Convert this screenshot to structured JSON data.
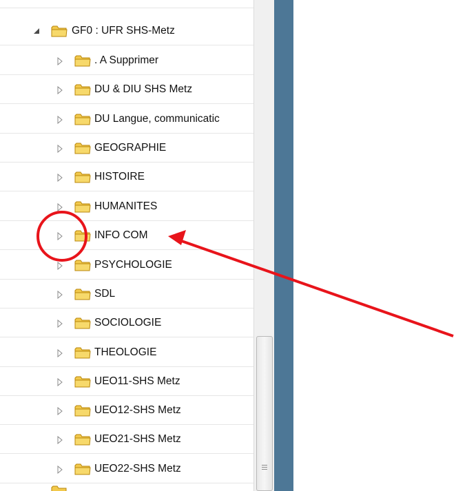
{
  "tree": {
    "parent": {
      "label": "GF0 : UFR SHS-Metz"
    },
    "children": [
      {
        "label": ". A Supprimer"
      },
      {
        "label": "DU & DIU SHS Metz"
      },
      {
        "label": "DU Langue, communicatic"
      },
      {
        "label": "GEOGRAPHIE"
      },
      {
        "label": "HISTOIRE"
      },
      {
        "label": "HUMANITES"
      },
      {
        "label": "INFO COM"
      },
      {
        "label": "PSYCHOLOGIE"
      },
      {
        "label": "SDL"
      },
      {
        "label": "SOCIOLOGIE"
      },
      {
        "label": "THEOLOGIE"
      },
      {
        "label": "UEO11-SHS Metz"
      },
      {
        "label": "UEO12-SHS Metz"
      },
      {
        "label": "UEO21-SHS Metz"
      },
      {
        "label": "UEO22-SHS Metz"
      }
    ]
  },
  "icons": {
    "folder": "folder-icon",
    "expand_collapsed": "triangle-right-icon",
    "expand_expanded": "triangle-down-icon"
  },
  "colors": {
    "annotation_red": "#e8141b",
    "side_pane_blue": "#4d7796",
    "folder_yellow": "#f2c94c"
  }
}
